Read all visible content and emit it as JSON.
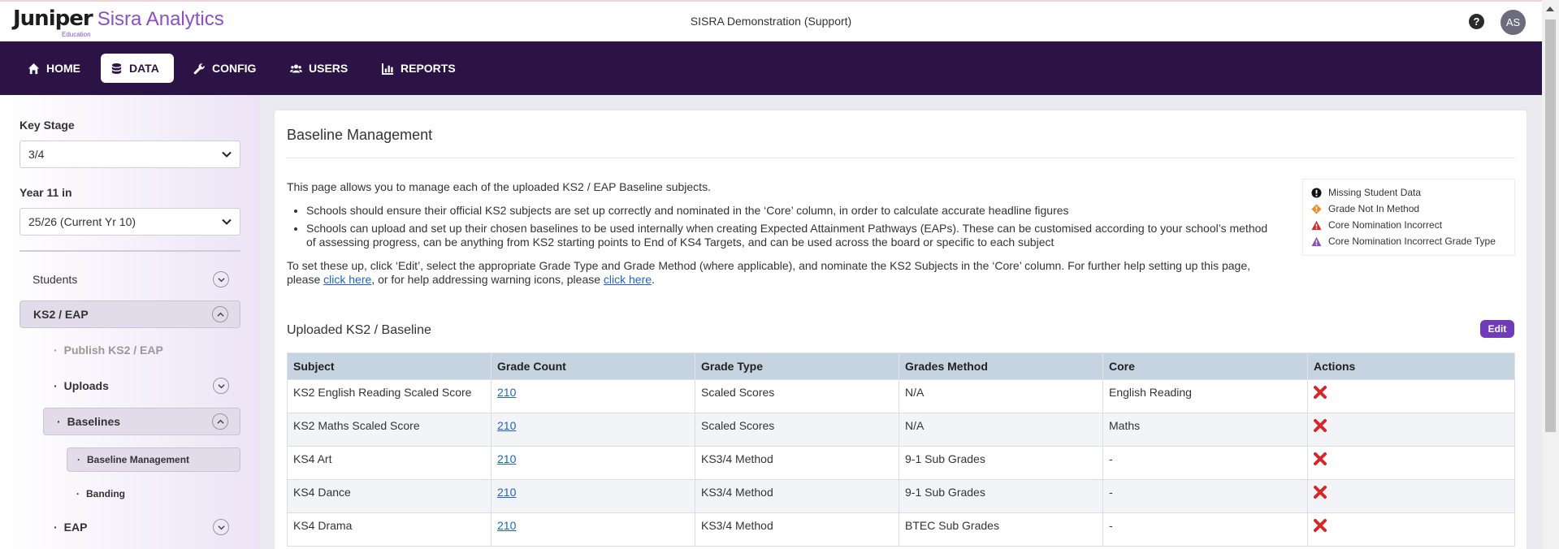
{
  "header": {
    "logo_main": "Juniper",
    "logo_sub": "Education",
    "app_name": "Sisra Analytics",
    "org_name": "SISRA Demonstration (Support)",
    "help_icon": "question-circle-icon",
    "avatar_initials": "AS"
  },
  "nav": {
    "items": [
      {
        "label": "HOME",
        "icon": "home-icon"
      },
      {
        "label": "DATA",
        "icon": "database-icon"
      },
      {
        "label": "CONFIG",
        "icon": "wrench-icon"
      },
      {
        "label": "USERS",
        "icon": "users-icon"
      },
      {
        "label": "REPORTS",
        "icon": "chart-icon"
      }
    ],
    "active": "DATA"
  },
  "sidebar": {
    "key_stage_label": "Key Stage",
    "key_stage_value": "3/4",
    "year_label": "Year 11 in",
    "year_value": "25/26 (Current Yr 10)",
    "items": [
      {
        "label": "Students"
      },
      {
        "label": "KS2 / EAP"
      },
      {
        "label": "Publish KS2 / EAP"
      },
      {
        "label": "Uploads"
      },
      {
        "label": "Baselines"
      },
      {
        "label": "Baseline Management"
      },
      {
        "label": "Banding"
      },
      {
        "label": "EAP"
      }
    ]
  },
  "main": {
    "title": "Baseline Management",
    "intro": "This page allows you to manage each of the uploaded KS2 / EAP Baseline subjects.",
    "bullets": [
      "Schools should ensure their official KS2 subjects are set up correctly and nominated in the ‘Core’ column, in order to calculate accurate headline figures",
      "Schools can upload and set up their chosen baselines to be used internally when creating Expected Attainment Pathways (EAPs). These can be customised according to your school’s method of assessing progress, can be anything from KS2 starting points to End of KS4 Targets, and can be used across the board or specific to each subject"
    ],
    "help_text_1": "To set these up, click ‘Edit’, select the appropriate Grade Type and Grade Method (where applicable), and nominate the KS2 Subjects in the ‘Core’ column. For further help setting up this page, please ",
    "link_1": "click here",
    "help_text_2": ", or for help addressing warning icons, please ",
    "link_2": "click here",
    "help_text_3": ".",
    "legend": [
      {
        "label": "Missing Student Data",
        "icon": "exclamation-circle-icon",
        "color": "#111111"
      },
      {
        "label": "Grade Not In Method",
        "icon": "warning-diamond-icon",
        "color": "#f08a24"
      },
      {
        "label": "Core Nomination Incorrect",
        "icon": "warning-triangle-icon",
        "color": "#d9262b"
      },
      {
        "label": "Core Nomination Incorrect Grade Type",
        "icon": "warning-triangle-icon",
        "color": "#8a4fc6"
      }
    ],
    "section_title": "Uploaded KS2 / Baseline",
    "edit_label": "Edit",
    "table": {
      "headers": [
        "Subject",
        "Grade Count",
        "Grade Type",
        "Grades Method",
        "Core",
        "Actions"
      ],
      "rows": [
        {
          "subject": "KS2 English Reading Scaled Score",
          "count": "210",
          "type": "Scaled Scores",
          "method": "N/A",
          "core": "English Reading"
        },
        {
          "subject": "KS2 Maths Scaled Score",
          "count": "210",
          "type": "Scaled Scores",
          "method": "N/A",
          "core": "Maths"
        },
        {
          "subject": "KS4 Art",
          "count": "210",
          "type": "KS3/4 Method",
          "method": "9-1 Sub Grades",
          "core": "-"
        },
        {
          "subject": "KS4 Dance",
          "count": "210",
          "type": "KS3/4 Method",
          "method": "9-1 Sub Grades",
          "core": "-"
        },
        {
          "subject": "KS4 Drama",
          "count": "210",
          "type": "KS3/4 Method",
          "method": "BTEC Sub Grades",
          "core": "-"
        }
      ]
    },
    "delete_icon": "delete-x-icon",
    "delete_color": "#d9262b"
  },
  "colors": {
    "nav_bg": "#2c1346",
    "brand_purple": "#8a4fc6",
    "edit_button": "#6f3bb8",
    "table_header": "#c6d3e0"
  }
}
